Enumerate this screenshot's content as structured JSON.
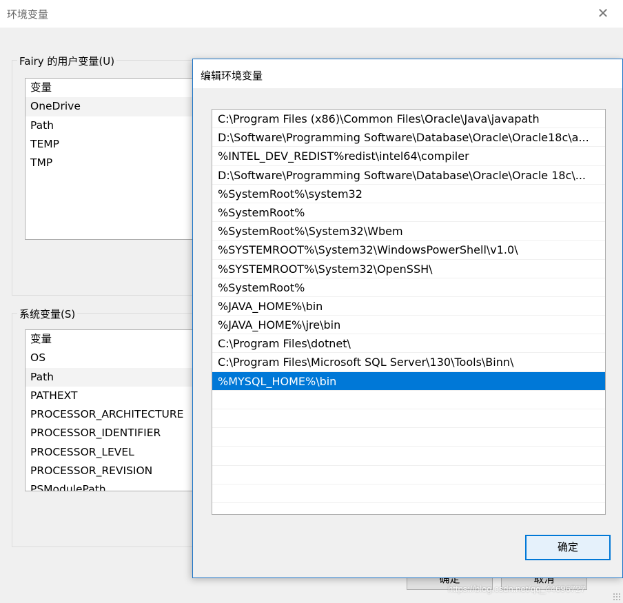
{
  "background_window": {
    "title": "环境变量",
    "close_glyph": "✕",
    "user_vars": {
      "group_label": "Fairy 的用户变量(U)",
      "header": "变量",
      "rows": [
        "OneDrive",
        "Path",
        "TEMP",
        "TMP"
      ]
    },
    "system_vars": {
      "group_label": "系统变量(S)",
      "header": "变量",
      "rows": [
        "OS",
        "Path",
        "PATHEXT",
        "PROCESSOR_ARCHITECTURE",
        "PROCESSOR_IDENTIFIER",
        "PROCESSOR_LEVEL",
        "PROCESSOR_REVISION",
        "PSModulePath"
      ]
    },
    "ok_label": "确定",
    "cancel_label": "取消"
  },
  "dialog": {
    "title": "编辑环境变量",
    "entries": [
      "C:\\Program Files (x86)\\Common Files\\Oracle\\Java\\javapath",
      "D:\\Software\\Programming Software\\Database\\Oracle\\Oracle18c\\a...",
      "%INTEL_DEV_REDIST%redist\\intel64\\compiler",
      "D:\\Software\\Programming Software\\Database\\Oracle\\Oracle 18c\\...",
      "%SystemRoot%\\system32",
      "%SystemRoot%",
      "%SystemRoot%\\System32\\Wbem",
      "%SYSTEMROOT%\\System32\\WindowsPowerShell\\v1.0\\",
      "%SYSTEMROOT%\\System32\\OpenSSH\\",
      "%SystemRoot%",
      "%JAVA_HOME%\\bin",
      "%JAVA_HOME%\\jre\\bin",
      "C:\\Program Files\\dotnet\\",
      "C:\\Program Files\\Microsoft SQL Server\\130\\Tools\\Binn\\",
      "%MYSQL_HOME%\\bin"
    ],
    "selected_index": 14,
    "ok_label": "确定"
  },
  "watermark": "https://blog.csdn.net/qq_44696727",
  "colors": {
    "selection": "#0078d7",
    "dialog_border": "#1a73c7",
    "button_focus_border": "#0078d7"
  }
}
